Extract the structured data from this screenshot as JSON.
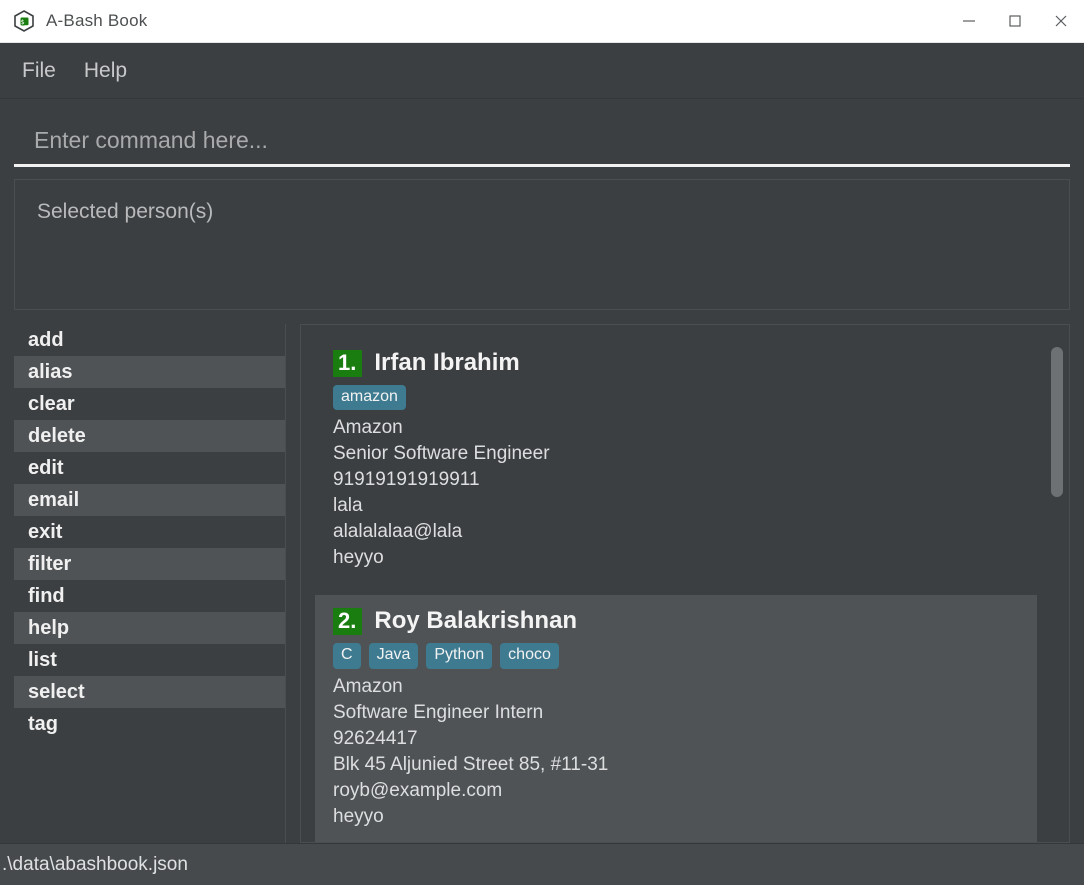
{
  "window": {
    "title": "A-Bash Book",
    "logo_icon": "bash-cube-icon",
    "controls": [
      {
        "name": "minimize-button",
        "icon": "minimize-icon"
      },
      {
        "name": "maximize-button",
        "icon": "maximize-icon"
      },
      {
        "name": "close-button",
        "icon": "close-icon"
      }
    ]
  },
  "menubar": {
    "items": [
      {
        "label": "File"
      },
      {
        "label": "Help"
      }
    ]
  },
  "command_input": {
    "placeholder": "Enter command here...",
    "value": ""
  },
  "selected_panel": {
    "label": "Selected person(s)",
    "entries": []
  },
  "command_list": {
    "items": [
      {
        "label": "add"
      },
      {
        "label": "alias"
      },
      {
        "label": "clear"
      },
      {
        "label": "delete"
      },
      {
        "label": "edit"
      },
      {
        "label": "email"
      },
      {
        "label": "exit"
      },
      {
        "label": "filter"
      },
      {
        "label": "find"
      },
      {
        "label": "help"
      },
      {
        "label": "list"
      },
      {
        "label": "select"
      },
      {
        "label": "tag"
      }
    ]
  },
  "results": {
    "persons": [
      {
        "index": "1.",
        "name": "Irfan Ibrahim",
        "tags": [
          "amazon"
        ],
        "fields": [
          "Amazon",
          "Senior Software Engineer",
          "91919191919911",
          "lala",
          "alalalalaa@lala",
          "heyyo"
        ],
        "selected": false
      },
      {
        "index": "2.",
        "name": "Roy Balakrishnan",
        "tags": [
          "C",
          "Java",
          "Python",
          "choco"
        ],
        "fields": [
          "Amazon",
          "Software Engineer Intern",
          "92624417",
          "Blk 45 Aljunied Street 85, #11-31",
          "royb@example.com",
          "heyyo"
        ],
        "selected": true
      }
    ]
  },
  "statusbar": {
    "path": ".\\data\\abashbook.json"
  },
  "colors": {
    "window_bg": "#3c3f41",
    "row_alt": "#4f5355",
    "accent_green": "#1a7d10",
    "tag_teal": "#3e7b91",
    "titlebar_bg": "#ffffff",
    "status_bg": "#474a4c"
  }
}
